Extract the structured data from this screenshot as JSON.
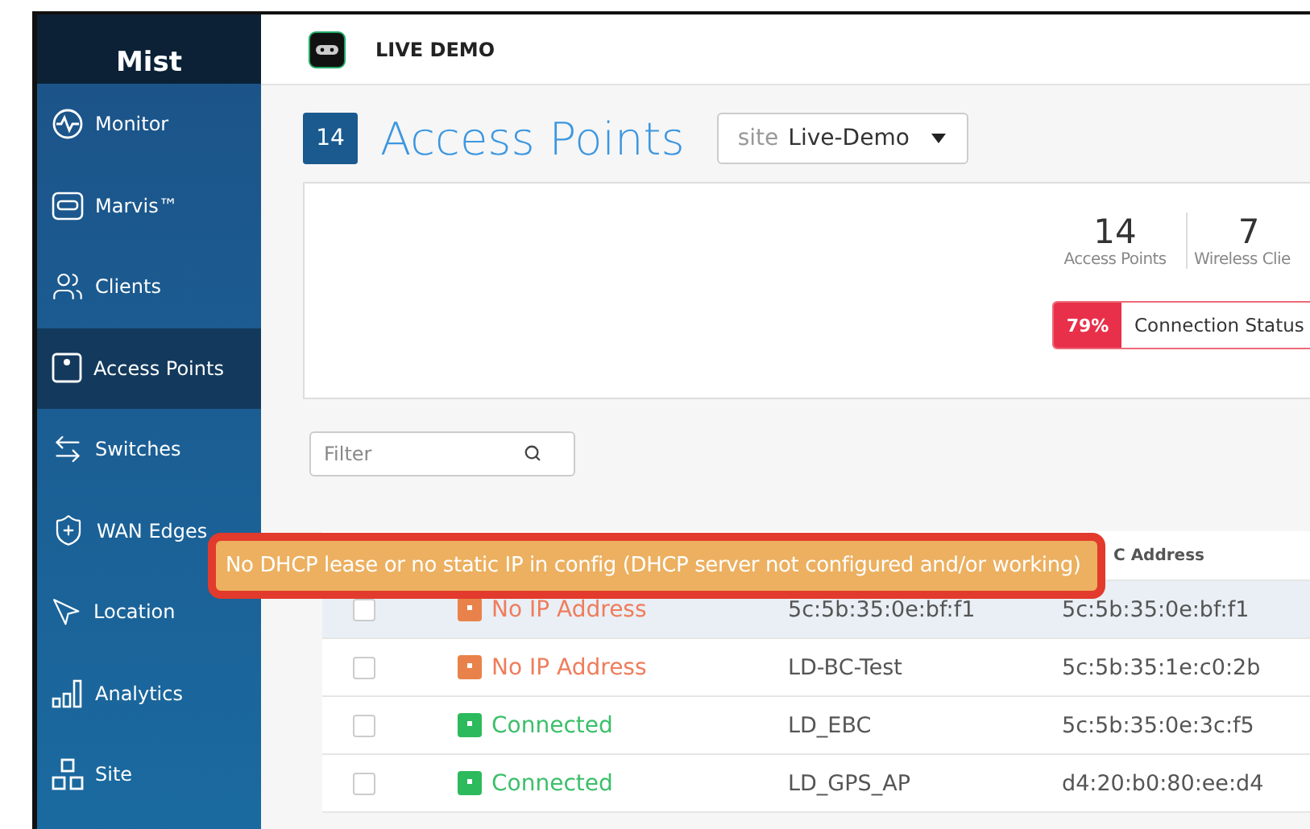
{
  "logo": "Mist",
  "sidebar": {
    "items": [
      {
        "label": "Monitor",
        "selected": false
      },
      {
        "label": "Marvis™",
        "selected": false
      },
      {
        "label": "Clients",
        "selected": false
      },
      {
        "label": "Access Points",
        "selected": true
      },
      {
        "label": "Switches",
        "selected": false
      },
      {
        "label": "WAN Edges",
        "selected": false
      },
      {
        "label": "Location",
        "selected": false
      },
      {
        "label": "Analytics",
        "selected": false
      },
      {
        "label": "Site",
        "selected": false
      }
    ]
  },
  "topbar": {
    "title": "LIVE DEMO"
  },
  "header": {
    "count": "14",
    "title": "Access Points",
    "site_label": "site",
    "site_value": "Live-Demo"
  },
  "stats": [
    {
      "value": "14",
      "label": "Access Points"
    },
    {
      "value": "7",
      "label": "Wireless Clie"
    }
  ],
  "connection": {
    "percent": "79%",
    "label": "Connection Status"
  },
  "filter": {
    "placeholder": "Filter"
  },
  "table": {
    "column_3": "C Address",
    "rows": [
      {
        "selected": true,
        "checked": false,
        "status": "No IP Address",
        "kind": "no_ip",
        "name": "5c:5b:35:0e:bf:f1",
        "mac": "5c:5b:35:0e:bf:f1"
      },
      {
        "selected": false,
        "checked": false,
        "status": "No IP Address",
        "kind": "no_ip",
        "name": "LD-BC-Test",
        "mac": "5c:5b:35:1e:c0:2b"
      },
      {
        "selected": false,
        "checked": false,
        "status": "Connected",
        "kind": "connected",
        "name": "LD_EBC",
        "mac": "5c:5b:35:0e:3c:f5"
      },
      {
        "selected": false,
        "checked": false,
        "status": "Connected",
        "kind": "connected",
        "name": "LD_GPS_AP",
        "mac": "d4:20:b0:80:ee:d4"
      }
    ]
  },
  "tooltip": "No DHCP lease or no static IP in config (DHCP server not configured and/or working)"
}
